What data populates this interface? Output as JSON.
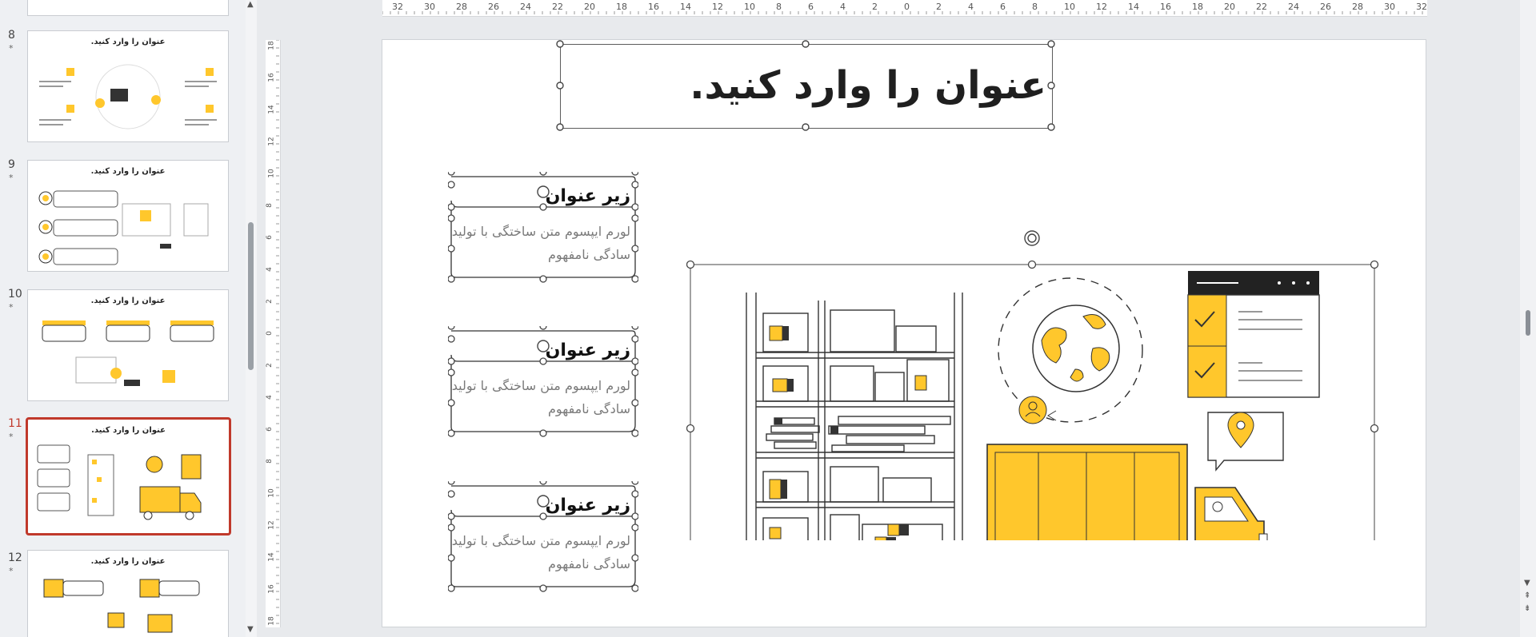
{
  "thumbnails": [
    {
      "number": "8",
      "title": "عنوان را وارد کنید."
    },
    {
      "number": "9",
      "title": "عنوان را وارد کنید."
    },
    {
      "number": "10",
      "title": "عنوان را وارد کنید."
    },
    {
      "number": "11",
      "title": "عنوان را وارد کنید."
    },
    {
      "number": "12",
      "title": "عنوان را وارد کنید."
    }
  ],
  "star": "*",
  "ruler": {
    "horizontal": [
      "32",
      "30",
      "28",
      "26",
      "24",
      "22",
      "20",
      "18",
      "16",
      "14",
      "12",
      "10",
      "8",
      "6",
      "4",
      "2",
      "0",
      "2",
      "4",
      "6",
      "8",
      "10",
      "12",
      "14",
      "16",
      "18",
      "20",
      "22",
      "24",
      "26",
      "28",
      "30",
      "32"
    ],
    "vertical": [
      "18",
      "16",
      "14",
      "12",
      "10",
      "8",
      "6",
      "4",
      "2",
      "0",
      "2",
      "4",
      "6",
      "8",
      "10",
      "12",
      "14",
      "16",
      "18"
    ]
  },
  "slide": {
    "title": "عنوان را وارد کنید.",
    "blocks": [
      {
        "heading": "زیر عنوان",
        "text": "لورم ایپسوم متن ساختگی با تولید سادگی نامفهوم"
      },
      {
        "heading": "زیر عنوان",
        "text": "لورم ایپسوم متن ساختگی با تولید سادگی نامفهوم"
      },
      {
        "heading": "زیر عنوان",
        "text": "لورم ایپسوم متن ساختگی با تولید سادگی نامفهوم"
      }
    ]
  },
  "colors": {
    "accent": "#ffc72c",
    "active_border": "#c0392b",
    "ink": "#222222"
  }
}
